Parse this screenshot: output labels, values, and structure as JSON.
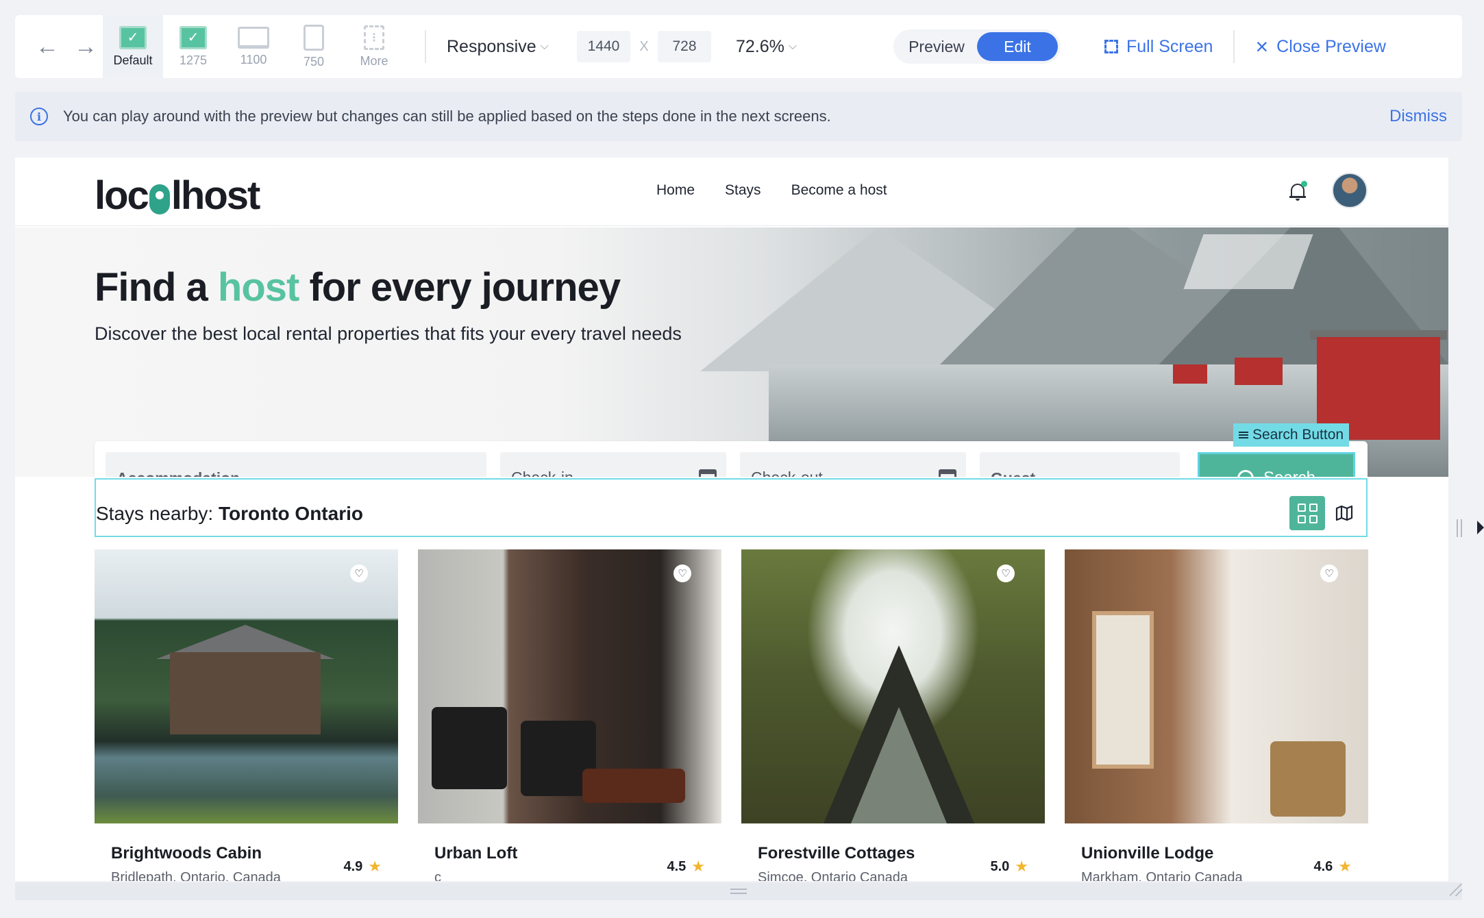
{
  "toolbar": {
    "breakpoints": [
      {
        "label": "Default"
      },
      {
        "label": "1275"
      },
      {
        "label": "1100"
      },
      {
        "label": "750"
      },
      {
        "label": "More"
      }
    ],
    "viewport_mode": "Responsive",
    "width_value": "1440",
    "separator": "X",
    "height_value": "728",
    "zoom": "72.6%",
    "preview_label": "Preview",
    "edit_label": "Edit",
    "full_screen_label": "Full Screen",
    "close_preview_label": "Close Preview"
  },
  "banner": {
    "text": "You can play around with the preview but changes can still be applied based on the steps done in the next screens.",
    "dismiss_label": "Dismiss"
  },
  "site": {
    "logo_prefix": "loc",
    "logo_suffix": "lhost",
    "nav": [
      "Home",
      "Stays",
      "Become a host"
    ],
    "hero": {
      "title_before": "Find a ",
      "title_accent": "host",
      "title_after": " for every journey",
      "subtitle": "Discover the best local rental properties that fits your every travel needs"
    },
    "search": {
      "accommodation_placeholder": "Accommodation",
      "checkin_placeholder": "Check-in",
      "checkout_placeholder": "Check-out",
      "guest_placeholder": "Guest",
      "button_label": "Search",
      "selection_tag": "Search Button"
    },
    "nearby": {
      "prefix": "Stays nearby: ",
      "location": "Toronto Ontario"
    },
    "listings": [
      {
        "name": "Brightwoods Cabin",
        "location": "Bridlepath, Ontario, Canada",
        "rating": "4.9"
      },
      {
        "name": "Urban Loft",
        "location": "c",
        "rating": "4.5"
      },
      {
        "name": "Forestville Cottages",
        "location": "Simcoe, Ontario Canada",
        "rating": "5.0"
      },
      {
        "name": "Unionville Lodge",
        "location": "Markham, Ontario Canada",
        "rating": "4.6"
      }
    ]
  },
  "colors": {
    "accent_blue": "#3b73e6",
    "brand_green": "#4fb59a",
    "selection_cyan": "#72dbe6",
    "star": "#f2b52f"
  },
  "icons": [
    "back-arrow-icon",
    "forward-arrow-icon",
    "desktop-check-icon",
    "laptop-icon",
    "tablet-icon",
    "more-icon",
    "chevron-down-icon",
    "full-screen-icon",
    "close-icon",
    "info-icon",
    "bell-icon",
    "calendar-icon",
    "search-icon",
    "grid-view-icon",
    "map-view-icon",
    "heart-icon",
    "star-icon"
  ]
}
